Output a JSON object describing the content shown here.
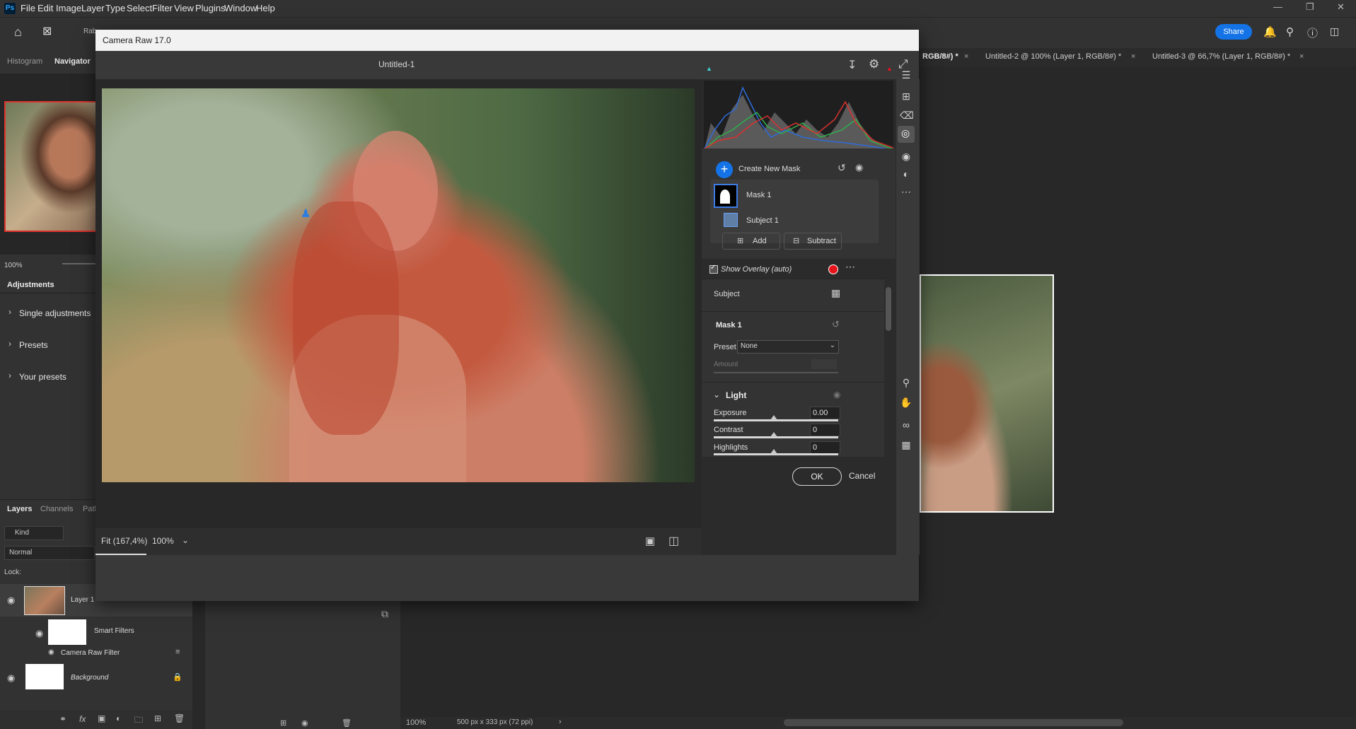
{
  "app": {
    "logo": "Ps",
    "menus": [
      "File",
      "Edit",
      "Image",
      "Layer",
      "Type",
      "Select",
      "Filter",
      "View",
      "Plugins",
      "Window",
      "Help"
    ],
    "share_label": "Share",
    "options_text": "Rab"
  },
  "doc_tabs": [
    "RGB/8#) *",
    "Untitled-2 @ 100% (Layer 1, RGB/8#) *",
    "Untitled-3 @ 66,7% (Layer 1, RGB/8#) *"
  ],
  "left_panel": {
    "tabs": [
      "Histogram",
      "Navigator"
    ],
    "nav_zoom": "100%",
    "adjustments_tab": "Adjustments",
    "adjustment_items": [
      "Single adjustments",
      "Presets",
      "Your presets"
    ],
    "layer_tabs": [
      "Layers",
      "Channels",
      "Path"
    ],
    "kind_label": "Kind",
    "blend_mode": "Normal",
    "lock_label": "Lock:",
    "layers": [
      {
        "name": "Layer 1"
      },
      {
        "name": "Smart Filters"
      },
      {
        "name": "Camera Raw Filter"
      },
      {
        "name": "Background"
      }
    ]
  },
  "status": {
    "zoom": "100%",
    "doc_size": "500 px x 333 px (72 ppi)"
  },
  "camera_raw": {
    "window_title": "Camera Raw 17.0",
    "doc_title": "Untitled-1",
    "fit_label": "Fit (167,4%)",
    "zoom_value": "100%",
    "create_mask": "Create New Mask",
    "mask_name": "Mask 1",
    "subject_name": "Subject 1",
    "add_label": "Add",
    "subtract_label": "Subtract",
    "overlay_label": "Show Overlay (auto)",
    "overlay_color": "#e8141b",
    "subject_section": "Subject",
    "mask_section": "Mask 1",
    "preset_label": "Preset",
    "preset_value": "None",
    "amount_label": "Amount",
    "light_section": "Light",
    "sliders": [
      {
        "label": "Exposure",
        "value": "0.00"
      },
      {
        "label": "Contrast",
        "value": "0"
      },
      {
        "label": "Highlights",
        "value": "0"
      }
    ],
    "ok_label": "OK",
    "cancel_label": "Cancel"
  }
}
